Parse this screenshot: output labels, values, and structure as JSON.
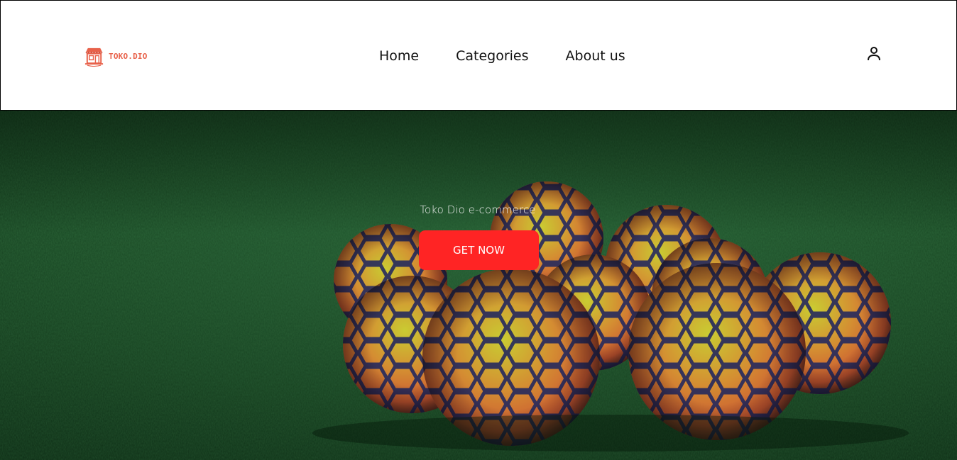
{
  "header": {
    "logo_text": "TOKO.DIO",
    "nav": [
      {
        "label": "Home"
      },
      {
        "label": "Categories"
      },
      {
        "label": "About us"
      }
    ],
    "user_icon": "user-icon"
  },
  "hero": {
    "tagline": "Toko Dio e-commerce",
    "cta_label": "GET NOW",
    "background": "soccer-balls-on-grass-photo"
  },
  "colors": {
    "brand": "#e8614a",
    "cta": "#ff2424",
    "nav_text": "#111111",
    "grass": "#1d5229"
  }
}
